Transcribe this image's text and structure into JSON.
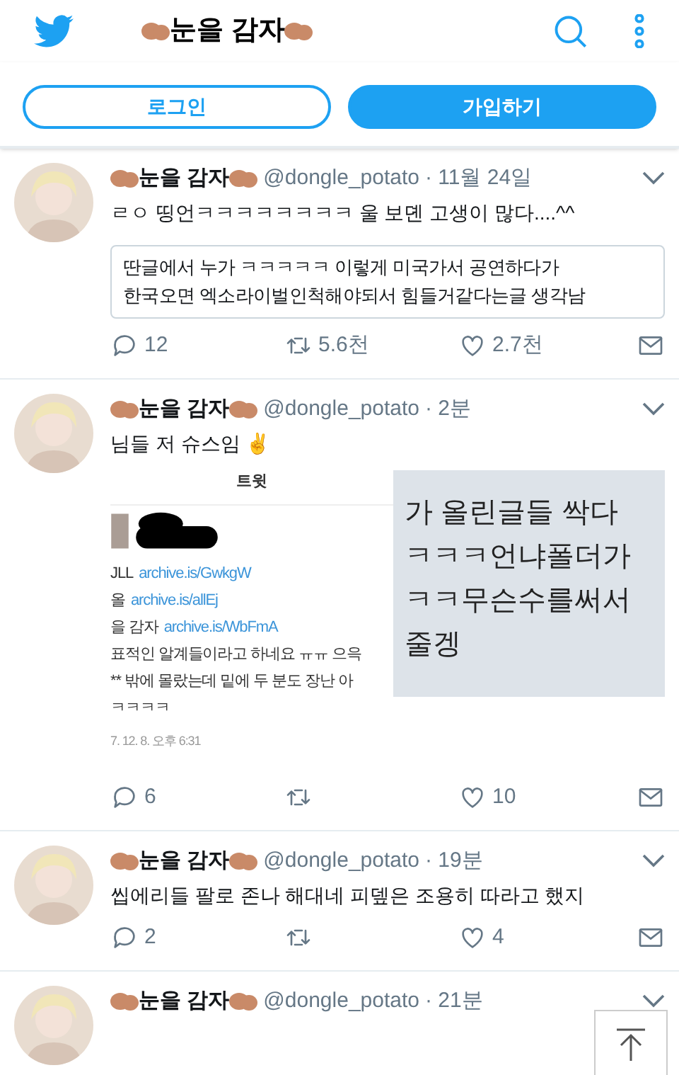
{
  "header": {
    "title": "눈을 감자"
  },
  "auth_buttons": [
    {
      "label": "로그인",
      "kind": "outline"
    },
    {
      "label": "가입하기",
      "kind": "filled"
    }
  ],
  "tweets": [
    {
      "kind": "quote",
      "name": "눈을 감자",
      "handle": "@dongle_potato",
      "time": "· 11월 24일",
      "text": "ㄹㅇ 띵언ㅋㅋㅋㅋㅋㅋㅋㅋ 울 보뎬 고생이 많다....^^",
      "quote": [
        "딴글에서 누가 ㅋㅋㅋㅋㅋ 이렇게 미국가서 공연하다가",
        "한국오면 엑소라이벌인척해야되서 힘들거같다는글 생각남"
      ],
      "replies": "12",
      "retweets": "5.6천",
      "likes": "2.7천"
    },
    {
      "kind": "embed",
      "name": "눈을 감자",
      "handle": "@dongle_potato",
      "time": "· 2분",
      "text": "님들 저 슈스임 ✌",
      "embed": {
        "title": "트윗",
        "links": [
          {
            "prefix": "JLL",
            "url": "archive.is/GwkgW"
          },
          {
            "prefix": "올",
            "url": "archive.is/allEj"
          },
          {
            "prefix": "을 감자",
            "url": "archive.is/WbFmA"
          }
        ],
        "lines": [
          "표적인 알계들이라고 하네요 ㅠㅠ 으윽",
          "** 밖에 몰랐는데 밑에 두 분도 장난 아",
          "ㅋㅋㅋㅋ"
        ],
        "date": "7. 12. 8. 오후 6:31",
        "overlay": [
          "가 올린글들 싹다",
          "ㅋㅋㅋ언냐폴더가",
          "ㅋㅋ무슨수를써서",
          "줄겡"
        ]
      },
      "replies": "6",
      "likes": "10"
    },
    {
      "kind": "text",
      "name": "눈을 감자",
      "handle": "@dongle_potato",
      "time": "· 19분",
      "text": "씹에리들 팔로 존나 해대네 피뎊은 조용히 따라고 했지",
      "replies": "2",
      "likes": "4"
    },
    {
      "kind": "partial",
      "name": "눈을 감자",
      "handle": "@dongle_potato",
      "time": "· 21분"
    }
  ]
}
